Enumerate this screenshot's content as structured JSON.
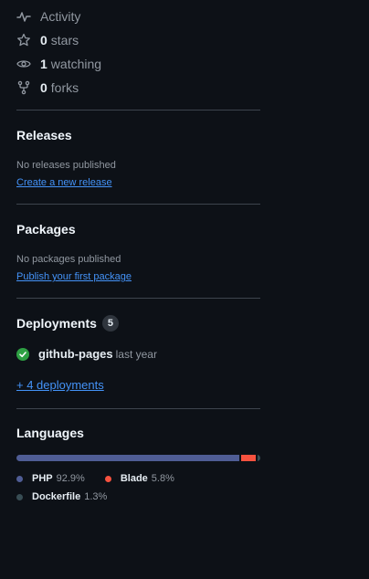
{
  "stats": {
    "activity": {
      "label": "Activity"
    },
    "stars": {
      "count": "0",
      "label": "stars"
    },
    "watching": {
      "count": "1",
      "label": "watching"
    },
    "forks": {
      "count": "0",
      "label": "forks"
    }
  },
  "releases": {
    "title": "Releases",
    "empty_text": "No releases published",
    "link": "Create a new release"
  },
  "packages": {
    "title": "Packages",
    "empty_text": "No packages published",
    "link": "Publish your first package"
  },
  "deployments": {
    "title": "Deployments",
    "count": "5",
    "items": [
      {
        "name": "github-pages",
        "time": "last year",
        "status": "success"
      }
    ],
    "more_link": "+ 4 deployments"
  },
  "languages": {
    "title": "Languages",
    "items": [
      {
        "name": "PHP",
        "percent": "92.9%",
        "value": 92.9,
        "color": "#4f5d95"
      },
      {
        "name": "Blade",
        "percent": "5.8%",
        "value": 5.8,
        "color": "#f7523f"
      },
      {
        "name": "Dockerfile",
        "percent": "1.3%",
        "value": 1.3,
        "color": "#384d54"
      }
    ]
  },
  "colors": {
    "background": "#0d1117",
    "link": "#4493f8",
    "muted": "#9198a1",
    "success": "#2ea043"
  }
}
